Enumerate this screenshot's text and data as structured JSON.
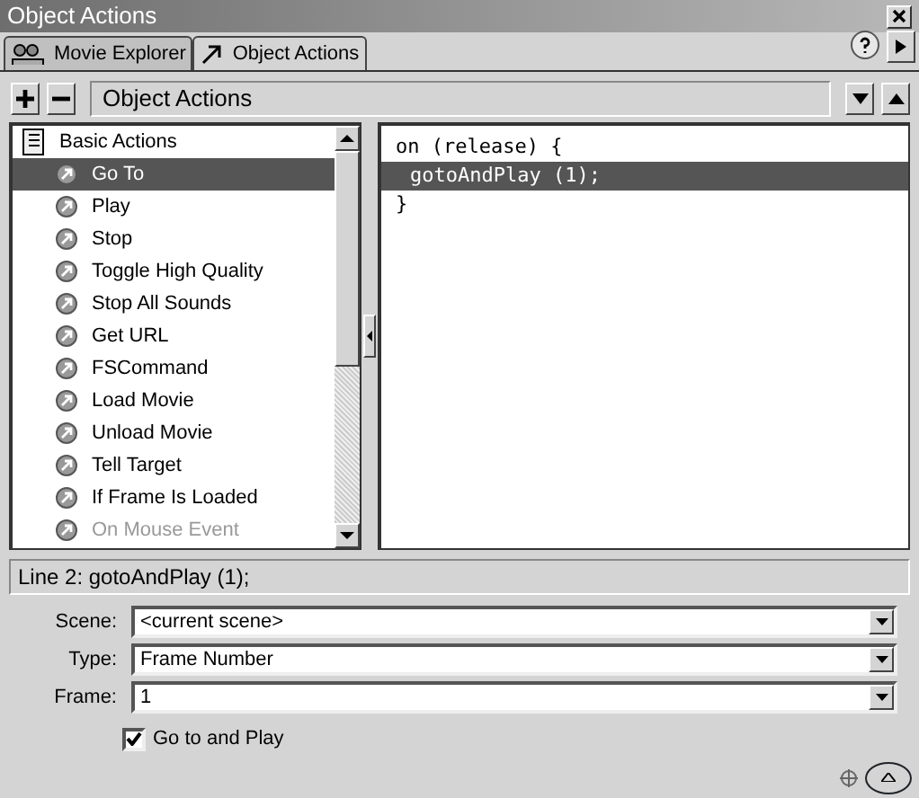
{
  "window": {
    "title": "Object Actions"
  },
  "tabs": [
    {
      "label": "Movie Explorer",
      "selected": false
    },
    {
      "label": "Object Actions",
      "selected": true
    }
  ],
  "toolbar": {
    "title": "Object Actions"
  },
  "actions": {
    "category": "Basic Actions",
    "items": [
      {
        "label": "Go To",
        "selected": true,
        "disabled": false
      },
      {
        "label": "Play",
        "selected": false,
        "disabled": false
      },
      {
        "label": "Stop",
        "selected": false,
        "disabled": false
      },
      {
        "label": "Toggle High Quality",
        "selected": false,
        "disabled": false
      },
      {
        "label": "Stop All Sounds",
        "selected": false,
        "disabled": false
      },
      {
        "label": "Get URL",
        "selected": false,
        "disabled": false
      },
      {
        "label": "FSCommand",
        "selected": false,
        "disabled": false
      },
      {
        "label": "Load Movie",
        "selected": false,
        "disabled": false
      },
      {
        "label": "Unload Movie",
        "selected": false,
        "disabled": false
      },
      {
        "label": "Tell Target",
        "selected": false,
        "disabled": false
      },
      {
        "label": "If Frame Is Loaded",
        "selected": false,
        "disabled": false
      },
      {
        "label": "On Mouse Event",
        "selected": false,
        "disabled": true
      }
    ]
  },
  "code": [
    {
      "text": "on (release) {",
      "selected": false,
      "children": [
        {
          "text": "gotoAndPlay (1);",
          "selected": true
        }
      ]
    },
    {
      "text": "}",
      "selected": false
    }
  ],
  "status_bar": "Line 2: gotoAndPlay (1);",
  "fields": [
    {
      "label": "Scene:",
      "value": "<current scene>"
    },
    {
      "label": "Type:",
      "value": "Frame Number"
    },
    {
      "label": "Frame:",
      "value": "1"
    }
  ],
  "checkbox": {
    "label": "Go to and Play",
    "checked": true
  }
}
